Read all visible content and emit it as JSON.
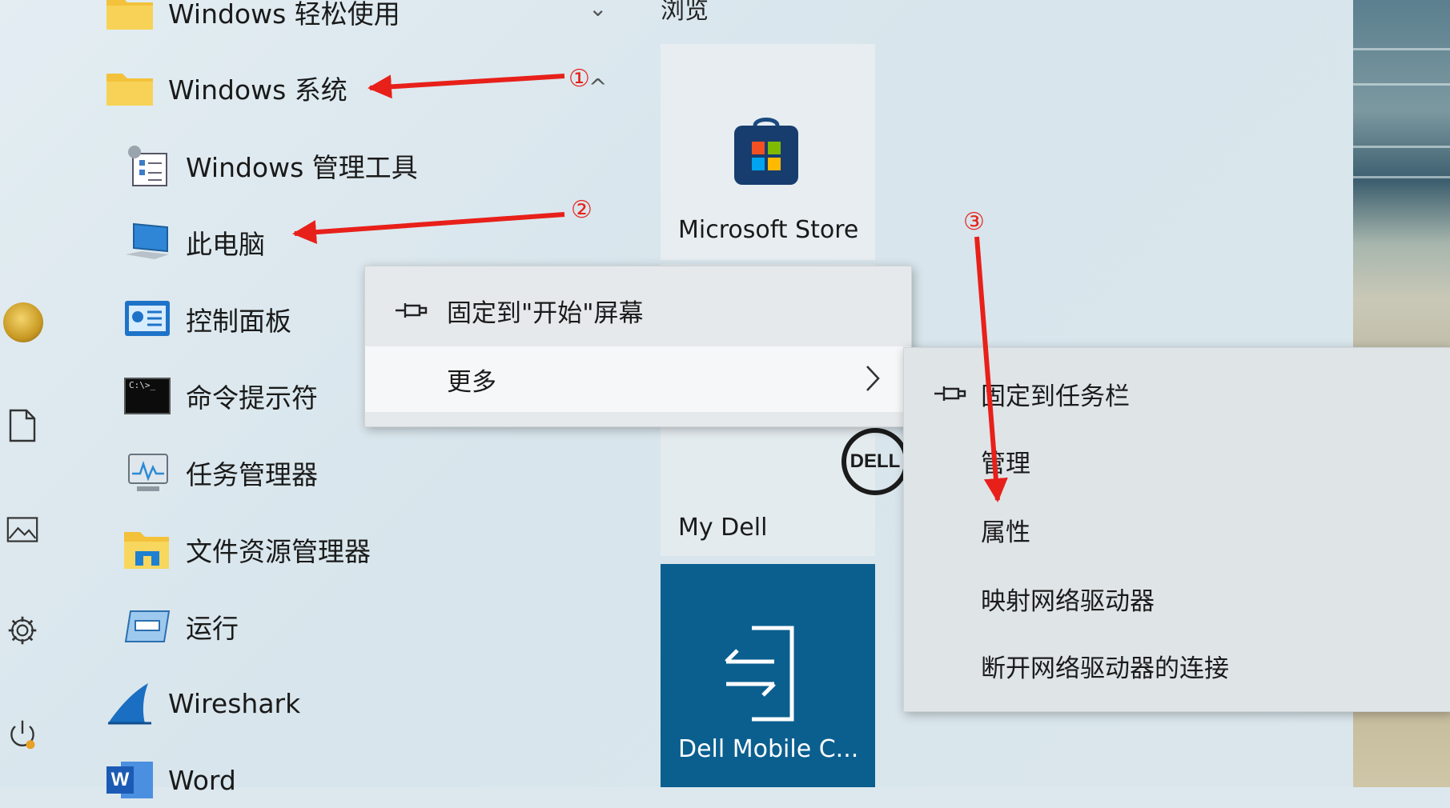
{
  "apps": [
    {
      "label": "Windows 轻松使用",
      "icon": "folder-icon",
      "chevron": "⌄"
    },
    {
      "label": "Windows 系统",
      "icon": "folder-icon",
      "chevron": "^"
    },
    {
      "label": "Windows 管理工具",
      "icon": "admin-tools-icon"
    },
    {
      "label": "此电脑",
      "icon": "this-pc-icon"
    },
    {
      "label": "控制面板",
      "icon": "control-panel-icon"
    },
    {
      "label": "命令提示符",
      "icon": "cmd-icon",
      "icon_text": "C:\\>_"
    },
    {
      "label": "任务管理器",
      "icon": "task-manager-icon"
    },
    {
      "label": "文件资源管理器",
      "icon": "file-explorer-icon"
    },
    {
      "label": "运行",
      "icon": "run-icon"
    },
    {
      "label": "Wireshark",
      "icon": "wireshark-icon"
    },
    {
      "label": "Word",
      "icon": "word-icon",
      "icon_text": "W"
    }
  ],
  "tiles": {
    "section_header": "浏览",
    "store": {
      "label": "Microsoft Store"
    },
    "mydell": {
      "label": "My Dell",
      "logo_text": "DELL"
    },
    "dellmobile": {
      "label": "Dell Mobile C...",
      "color": "#0a5f8f"
    }
  },
  "context_menu": {
    "pin_start": "固定到\"开始\"屏幕",
    "more": "更多"
  },
  "submenu": {
    "items": [
      "固定到任务栏",
      "管理",
      "属性",
      "映射网络驱动器",
      "断开网络驱动器的连接"
    ]
  },
  "annotations": {
    "step1": "①",
    "step2": "②",
    "step3": "③",
    "arrow_color": "#e8201a"
  }
}
